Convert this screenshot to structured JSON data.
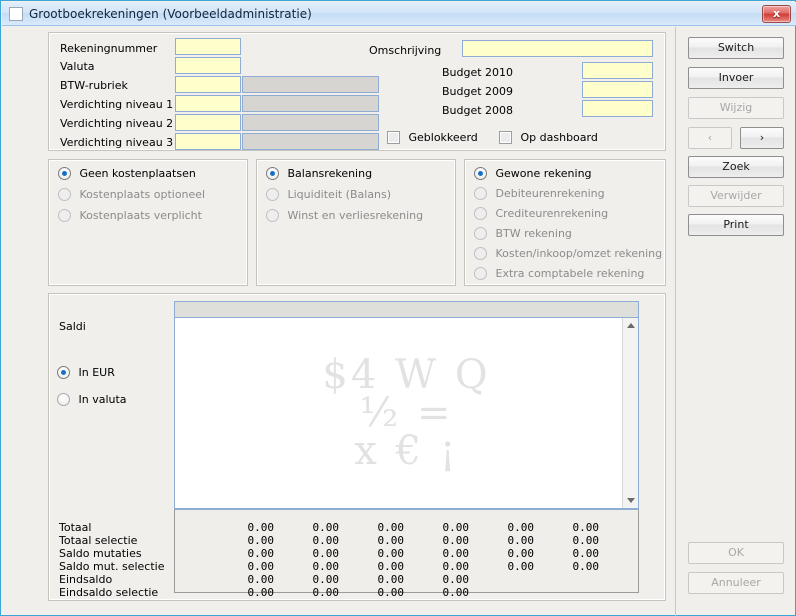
{
  "window": {
    "title": "Grootboekrekeningen (Voorbeeldadministratie)",
    "close_label": "x",
    "accent_color": "#3ca5d8",
    "titlebar_color": "#c5dcf5",
    "field_color": "#ffffcc",
    "readonly_color": "#d6d5d1",
    "radio_dot_color": "#1a6fc4"
  },
  "form": {
    "fields": [
      {
        "label": "Rekeningnummer",
        "value": "",
        "has_readonly": false
      },
      {
        "label": "Valuta",
        "value": "",
        "has_readonly": false
      },
      {
        "label": "BTW-rubriek",
        "value": "",
        "has_readonly": true
      },
      {
        "label": "Verdichting niveau 1",
        "value": "",
        "has_readonly": true
      },
      {
        "label": "Verdichting niveau 2",
        "value": "",
        "has_readonly": true
      },
      {
        "label": "Verdichting niveau 3",
        "value": "",
        "has_readonly": true
      }
    ],
    "omschrijving": {
      "label": "Omschrijving",
      "value": ""
    },
    "budgets": [
      {
        "label": "Budget 2010",
        "value": ""
      },
      {
        "label": "Budget 2009",
        "value": ""
      },
      {
        "label": "Budget 2008",
        "value": ""
      }
    ],
    "checkboxes": [
      {
        "label": "Geblokkeerd",
        "checked": false
      },
      {
        "label": "Op dashboard",
        "checked": false
      }
    ]
  },
  "kostenplaats_group": {
    "options": [
      {
        "label": "Geen kostenplaatsen",
        "selected": true,
        "enabled": true
      },
      {
        "label": "Kostenplaats optioneel",
        "selected": false,
        "enabled": false
      },
      {
        "label": "Kostenplaats verplicht",
        "selected": false,
        "enabled": false
      }
    ]
  },
  "rekeningtype_group": {
    "options": [
      {
        "label": "Balansrekening",
        "selected": true,
        "enabled": true
      },
      {
        "label": "Liquiditeit (Balans)",
        "selected": false,
        "enabled": false
      },
      {
        "label": "Winst en verliesrekening",
        "selected": false,
        "enabled": false
      }
    ]
  },
  "soort_group": {
    "options": [
      {
        "label": "Gewone rekening",
        "selected": true,
        "enabled": true
      },
      {
        "label": "Debiteurenrekening",
        "selected": false,
        "enabled": false
      },
      {
        "label": "Crediteurenrekening",
        "selected": false,
        "enabled": false
      },
      {
        "label": "BTW rekening",
        "selected": false,
        "enabled": false
      },
      {
        "label": "Kosten/inkoop/omzet rekening",
        "selected": false,
        "enabled": false
      },
      {
        "label": "Extra comptabele rekening",
        "selected": false,
        "enabled": false
      }
    ]
  },
  "saldi": {
    "title": "Saldi",
    "currency_options": [
      {
        "label": "In EUR",
        "selected": true
      },
      {
        "label": "In valuta",
        "selected": false
      }
    ],
    "watermark_lines": [
      "$4 W Q",
      "½ =",
      "x  € ¡"
    ]
  },
  "totals": {
    "rows": [
      {
        "label": "Totaal",
        "values": [
          "0.00",
          "0.00",
          "0.00",
          "0.00",
          "0.00",
          "0.00"
        ]
      },
      {
        "label": "Totaal selectie",
        "values": [
          "0.00",
          "0.00",
          "0.00",
          "0.00",
          "0.00",
          "0.00"
        ]
      },
      {
        "label": "Saldo mutaties",
        "values": [
          "0.00",
          "0.00",
          "0.00",
          "0.00",
          "0.00",
          "0.00"
        ]
      },
      {
        "label": "Saldo mut. selectie",
        "values": [
          "0.00",
          "0.00",
          "0.00",
          "0.00",
          "0.00",
          "0.00"
        ]
      },
      {
        "label": "Eindsaldo",
        "values": [
          "0.00",
          "0.00",
          "0.00",
          "0.00"
        ]
      },
      {
        "label": "Eindsaldo selectie",
        "values": [
          "0.00",
          "0.00",
          "0.00",
          "0.00"
        ]
      }
    ]
  },
  "sidebar": {
    "buttons": [
      {
        "label": "Switch",
        "enabled": true
      },
      {
        "label": "Invoer",
        "enabled": true
      },
      {
        "label": "Wijzig",
        "enabled": false
      },
      {
        "label": "Zoek",
        "enabled": true
      },
      {
        "label": "Verwijder",
        "enabled": false
      },
      {
        "label": "Print",
        "enabled": true
      }
    ],
    "nav": {
      "prev_label": "‹",
      "next_label": "›",
      "prev_enabled": false,
      "next_enabled": true
    },
    "footer_buttons": [
      {
        "label": "OK",
        "enabled": false
      },
      {
        "label": "Annuleer",
        "enabled": false
      }
    ]
  }
}
